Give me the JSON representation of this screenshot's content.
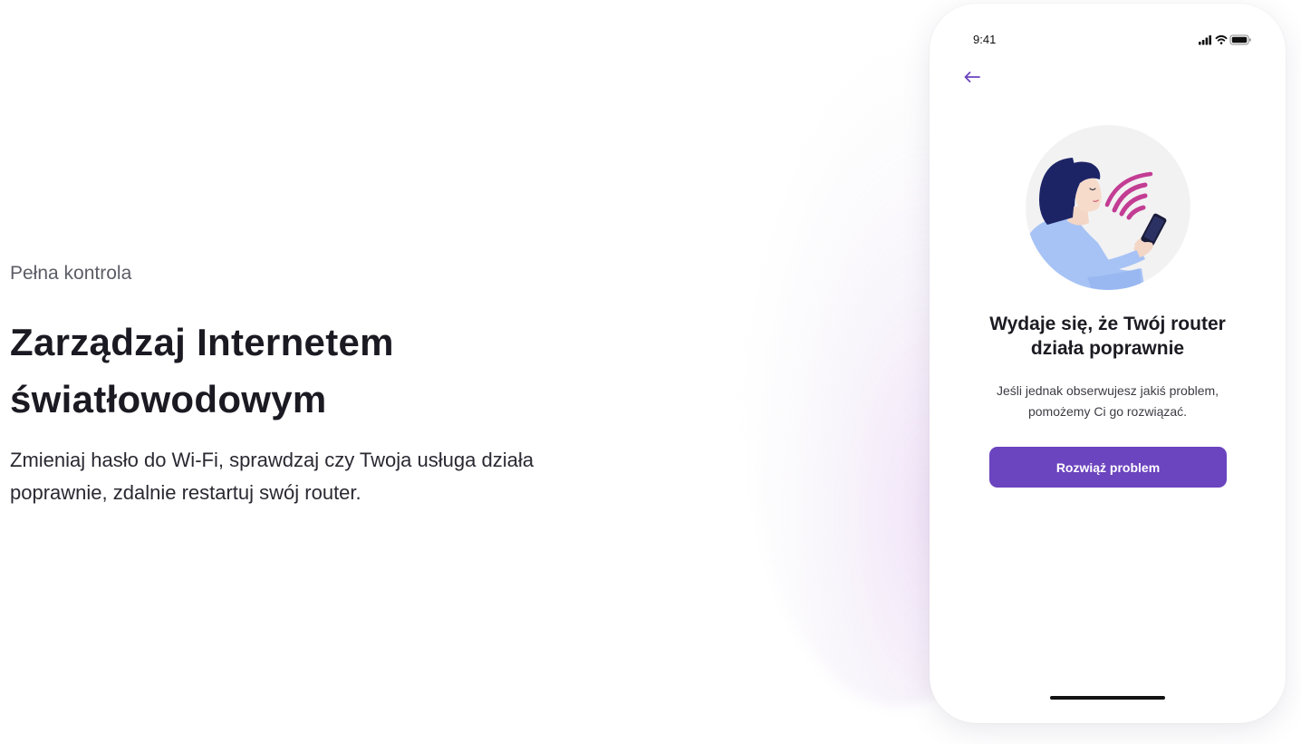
{
  "hero": {
    "eyebrow": "Pełna kontrola",
    "headline_line1": "Zarządzaj Internetem",
    "headline_line2": "światłowodowym",
    "description": "Zmieniaj hasło do Wi-Fi,  sprawdzaj czy Twoja usługa działa poprawnie, zdalnie restartuj swój router."
  },
  "phone": {
    "status_time": "9:41",
    "status_icons": [
      "signal-icon",
      "wifi-icon",
      "battery-icon"
    ],
    "back_icon": "arrow-left-icon",
    "illustration": "woman-with-phone-wifi-illustration",
    "title_line1": "Wydaje się, że Twój router",
    "title_line2": "działa poprawnie",
    "subtitle_line1": "Jeśli jednak obserwujesz  jakiś problem,",
    "subtitle_line2": "pomożemy Ci go rozwiązać.",
    "cta_label": "Rozwiąż problem"
  },
  "colors": {
    "accent": "#6b44bf",
    "heading": "#1b1a22",
    "wifi_arcs": "#c33d93",
    "illustration_bg": "#f2f2f3",
    "sweater": "#a7c3f5",
    "hair": "#1d2466"
  }
}
